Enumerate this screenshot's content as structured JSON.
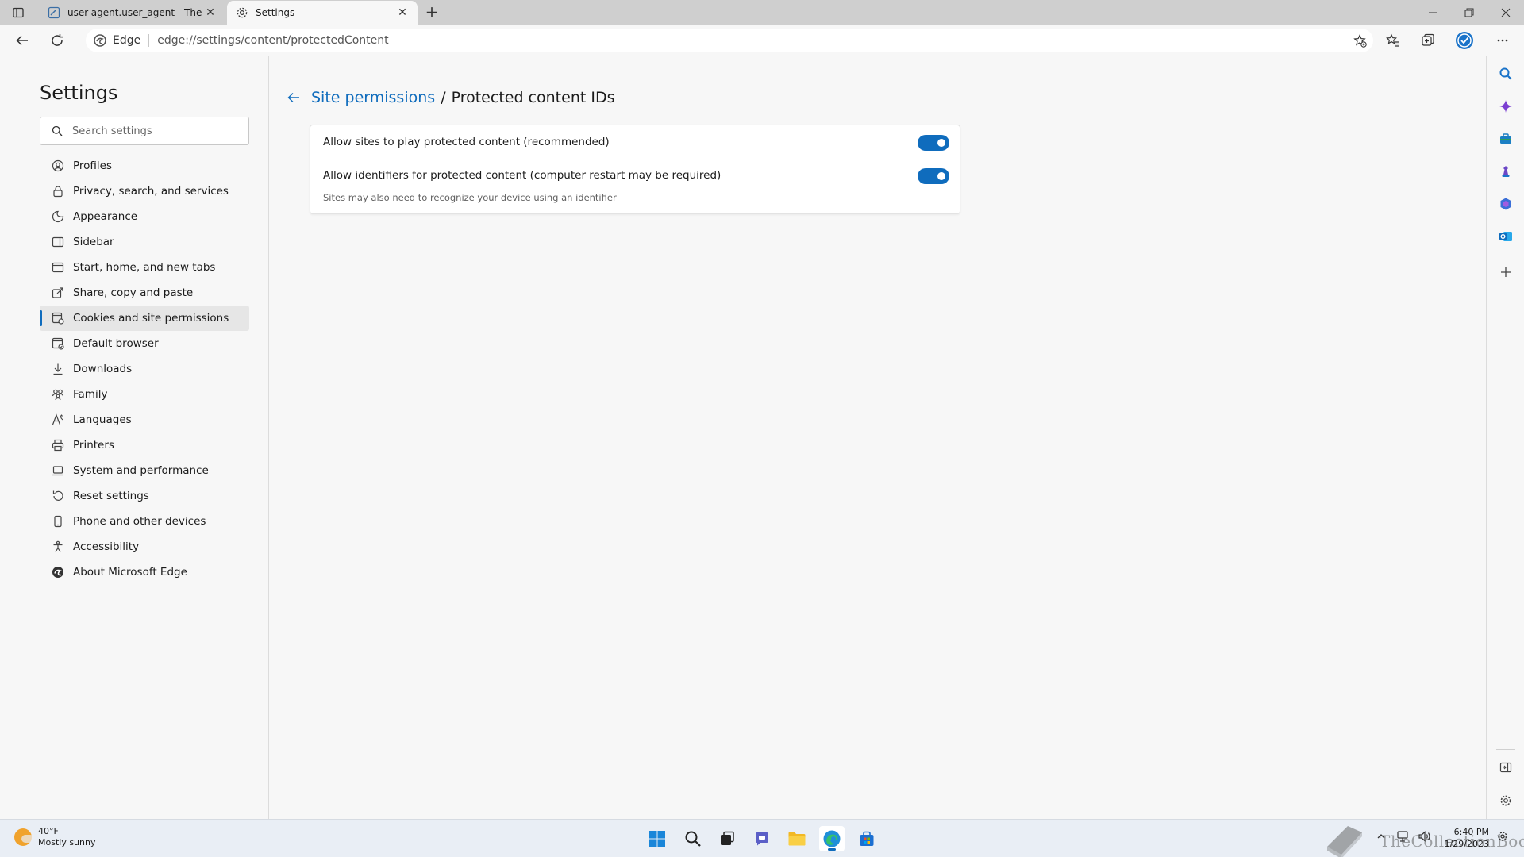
{
  "browser": {
    "tabs": [
      {
        "title": "user-agent.user_agent - The Coll",
        "active": false
      },
      {
        "title": "Settings",
        "active": true
      }
    ],
    "address": {
      "identity_label": "Edge",
      "url": "edge://settings/content/protectedContent"
    }
  },
  "settings": {
    "title": "Settings",
    "search_placeholder": "Search settings",
    "nav": [
      {
        "label": "Profiles",
        "icon": "profile-icon"
      },
      {
        "label": "Privacy, search, and services",
        "icon": "lock-icon"
      },
      {
        "label": "Appearance",
        "icon": "appearance-icon"
      },
      {
        "label": "Sidebar",
        "icon": "sidebar-icon"
      },
      {
        "label": "Start, home, and new tabs",
        "icon": "home-icon"
      },
      {
        "label": "Share, copy and paste",
        "icon": "share-icon"
      },
      {
        "label": "Cookies and site permissions",
        "icon": "cookies-icon",
        "selected": true
      },
      {
        "label": "Default browser",
        "icon": "browser-icon"
      },
      {
        "label": "Downloads",
        "icon": "download-icon"
      },
      {
        "label": "Family",
        "icon": "family-icon"
      },
      {
        "label": "Languages",
        "icon": "language-icon"
      },
      {
        "label": "Printers",
        "icon": "printer-icon"
      },
      {
        "label": "System and performance",
        "icon": "laptop-icon"
      },
      {
        "label": "Reset settings",
        "icon": "reset-icon"
      },
      {
        "label": "Phone and other devices",
        "icon": "phone-icon"
      },
      {
        "label": "Accessibility",
        "icon": "accessibility-icon"
      },
      {
        "label": "About Microsoft Edge",
        "icon": "edge-logo-icon"
      }
    ]
  },
  "content": {
    "breadcrumb_link": "Site permissions",
    "breadcrumb_separator": "/",
    "page_title": "Protected content IDs",
    "options": [
      {
        "label": "Allow sites to play protected content (recommended)",
        "enabled": true,
        "description": ""
      },
      {
        "label": "Allow identifiers for protected content (computer restart may be required)",
        "enabled": true,
        "description": "Sites may also need to recognize your device using an identifier"
      }
    ]
  },
  "taskbar": {
    "weather_temp": "40°F",
    "weather_desc": "Mostly sunny",
    "watermark": "TheCollectionBook",
    "time": "6:40 PM",
    "date": "1/29/2023"
  },
  "colors": {
    "accent": "#0f6cbd",
    "background": "#f7f7f7",
    "tabstrip": "#cfcfcf"
  }
}
